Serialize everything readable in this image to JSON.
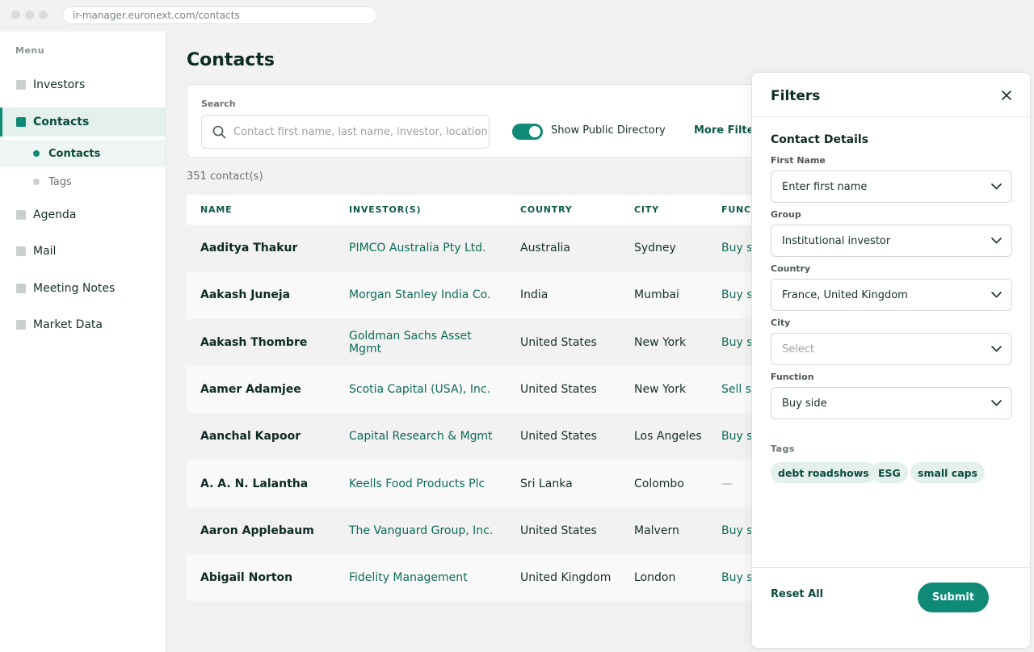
{
  "browser": {
    "url": "ir-manager.euronext.com/contacts"
  },
  "sidebar": {
    "menu_label": "Menu",
    "items": [
      {
        "label": "Investors"
      },
      {
        "label": "Contacts"
      },
      {
        "label": "Agenda"
      },
      {
        "label": "Mail"
      },
      {
        "label": "Meeting Notes"
      },
      {
        "label": "Market Data"
      }
    ],
    "sub_items": [
      {
        "label": "Contacts"
      },
      {
        "label": "Tags"
      }
    ]
  },
  "main": {
    "title": "Contacts",
    "search": {
      "label": "Search",
      "placeholder": "Contact first name, last name, investor, location..."
    },
    "toggle_label": "Show Public Directory",
    "more_filters": "More Filters",
    "count": "351 contact(s)"
  },
  "table": {
    "headers": [
      "NAME",
      "INVESTOR(S)",
      "COUNTRY",
      "CITY",
      "FUNCTION"
    ],
    "rows": [
      {
        "name": "Aaditya Thakur",
        "investor": "PIMCO Australia Pty Ltd.",
        "country": "Australia",
        "city": "Sydney",
        "function": "Buy side"
      },
      {
        "name": "Aakash Juneja",
        "investor": "Morgan Stanley India Co.",
        "country": "India",
        "city": "Mumbai",
        "function": "Buy side"
      },
      {
        "name": "Aakash Thombre",
        "investor": "Goldman Sachs Asset Mgmt",
        "country": "United States",
        "city": "New York",
        "function": "Buy side"
      },
      {
        "name": "Aamer Adamjee",
        "investor": "Scotia Capital (USA), Inc.",
        "country": "United States",
        "city": "New York",
        "function": "Sell side"
      },
      {
        "name": "Aanchal Kapoor",
        "investor": "Capital Research & Mgmt",
        "country": "United States",
        "city": "Los Angeles",
        "function": "Buy side"
      },
      {
        "name": "A. A. N. Lalantha",
        "investor": "Keells Food Products Plc",
        "country": "Sri Lanka",
        "city": "Colombo",
        "function": "—"
      },
      {
        "name": "Aaron Applebaum",
        "investor": "The Vanguard Group, Inc.",
        "country": "United States",
        "city": "Malvern",
        "function": "Buy side"
      },
      {
        "name": "Abigail Norton",
        "investor": "Fidelity Management",
        "country": "United Kingdom",
        "city": "London",
        "function": "Buy side"
      }
    ]
  },
  "filters": {
    "title": "Filters",
    "section": "Contact Details",
    "fields": [
      {
        "label": "First Name",
        "value": "Enter first name"
      },
      {
        "label": "Group",
        "value": "Institutional investor"
      },
      {
        "label": "Country",
        "value": "France, United Kingdom"
      },
      {
        "label": "City",
        "value": "Select"
      },
      {
        "label": "Function",
        "value": "Buy side"
      }
    ],
    "tags_label": "Tags",
    "tags": [
      "debt roadshows",
      "ESG",
      "small caps"
    ],
    "reset_label": "Reset All",
    "submit_label": "Submit"
  },
  "colors": {
    "accent": "#0f8a76",
    "accent_dark": "#0d4a3e",
    "background": "#f1f2f1"
  }
}
